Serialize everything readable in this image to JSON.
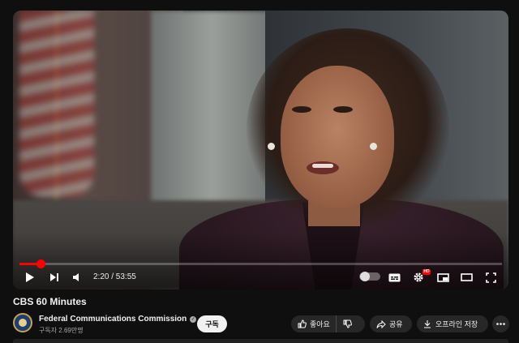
{
  "player": {
    "time_display": "2:20 / 53:55",
    "progress_fraction": 0.043,
    "controls": {
      "play_icon": "play-icon",
      "next_icon": "next-icon",
      "volume_icon": "volume-icon",
      "autoplay_icon": "autoplay-toggle",
      "subtitles_icon": "subtitles-icon",
      "settings_icon": "gear-icon",
      "settings_badge": "HD",
      "miniplayer_icon": "miniplayer-icon",
      "theater_icon": "theater-mode-icon",
      "fullscreen_icon": "fullscreen-icon"
    }
  },
  "video": {
    "title": "CBS 60 Minutes"
  },
  "channel": {
    "name": "Federal Communications Commission",
    "subscribers": "구독자 2.69만명",
    "subscribe_label": "구독"
  },
  "actions": {
    "like_label": "좋아요",
    "share_label": "공유",
    "offline_label": "오프라인 저장",
    "more_icon": "more-icon"
  },
  "colors": {
    "accent": "#ff0000",
    "background": "#0f0f0f",
    "pill": "#272727"
  }
}
